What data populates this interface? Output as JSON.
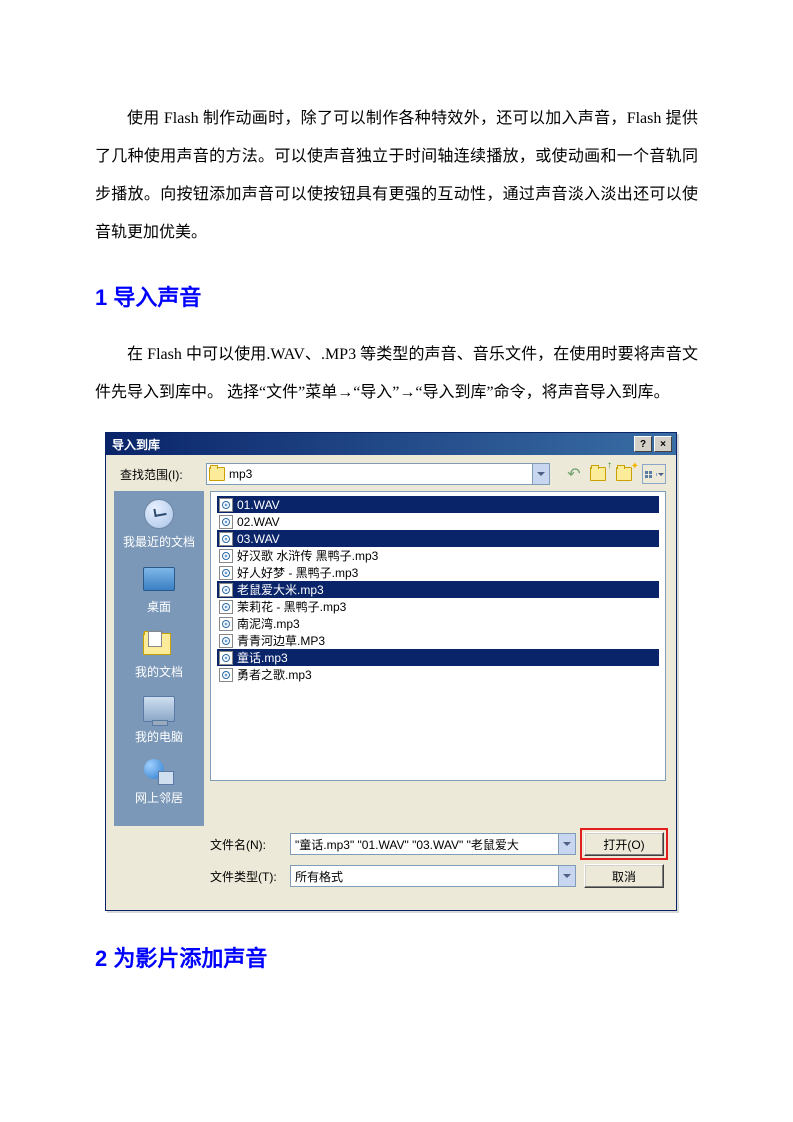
{
  "paragraph1": "使用 Flash 制作动画时，除了可以制作各种特效外，还可以加入声音，Flash 提供了几种使用声音的方法。可以使声音独立于时间轴连续播放，或使动画和一个音轨同步播放。向按钮添加声音可以使按钮具有更强的互动性，通过声音淡入淡出还可以使音轨更加优美。",
  "heading1": "1 导入声音",
  "paragraph2": "在 Flash 中可以使用.WAV、.MP3 等类型的声音、音乐文件，在使用时要将声音文件先导入到库中。 选择“文件”菜单→“导入”→“导入到库”命令，将声音导入到库。",
  "heading2": "2 为影片添加声音",
  "dialog": {
    "title": "导入到库",
    "close_glyph": "×",
    "help_glyph": "?",
    "lookin_label": "查找范围(I):",
    "lookin_value": "mp3",
    "places": {
      "recent": "我最近的文档",
      "desktop": "桌面",
      "mydocs": "我的文档",
      "mycomp": "我的电脑",
      "network": "网上邻居"
    },
    "files": [
      {
        "name": "01.WAV",
        "selected": true
      },
      {
        "name": "02.WAV",
        "selected": false
      },
      {
        "name": "03.WAV",
        "selected": true
      },
      {
        "name": "好汉歌 水浒传 黑鸭子.mp3",
        "selected": false
      },
      {
        "name": "好人好梦 - 黑鸭子.mp3",
        "selected": false
      },
      {
        "name": "老鼠爱大米.mp3",
        "selected": true
      },
      {
        "name": "茉莉花 - 黑鸭子.mp3",
        "selected": false
      },
      {
        "name": "南泥湾.mp3",
        "selected": false
      },
      {
        "name": "青青河边草.MP3",
        "selected": false
      },
      {
        "name": "童话.mp3",
        "selected": true
      },
      {
        "name": "勇者之歌.mp3",
        "selected": false
      }
    ],
    "filename_label": "文件名(N):",
    "filename_value": "\"童话.mp3\" \"01.WAV\" \"03.WAV\" \"老鼠爱大",
    "filetype_label": "文件类型(T):",
    "filetype_value": "所有格式",
    "open_btn": "打开(O)",
    "cancel_btn": "取消"
  }
}
